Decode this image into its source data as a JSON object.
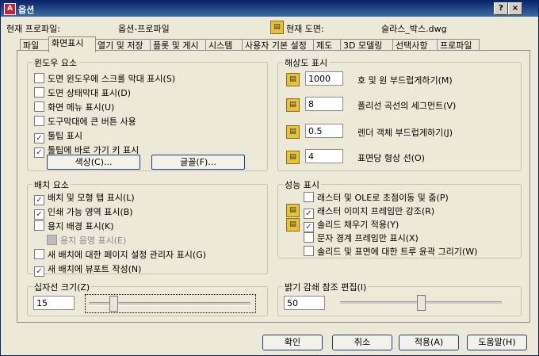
{
  "title_bar": {
    "title": "옵션",
    "help_button": "?",
    "close_button": "×"
  },
  "header": {
    "profile_label": "현재 프로파일:",
    "profile_value": "옵션-프로파일",
    "drawing_label": "현재 도면:",
    "drawing_value": "슬라스_박스.dwg"
  },
  "tabs": [
    {
      "label": "파일"
    },
    {
      "label": "화면표시",
      "active": true
    },
    {
      "label": "열기 및 저장"
    },
    {
      "label": "플롯 및 게시"
    },
    {
      "label": "시스템"
    },
    {
      "label": "사용자 기본 설정"
    },
    {
      "label": "제도"
    },
    {
      "label": "3D 모델링"
    },
    {
      "label": "선택사항"
    },
    {
      "label": "프로파일"
    }
  ],
  "window_elements": {
    "title": "윈도우 요소",
    "options": [
      {
        "label": "도면 윈도우에 스크롤 막대 표시(S)",
        "checked": false
      },
      {
        "label": "도면 상태막대 표시(D)",
        "checked": false
      },
      {
        "label": "화면 메뉴 표시(U)",
        "checked": false
      },
      {
        "label": "도구막대에 큰 버튼 사용",
        "checked": false
      },
      {
        "label": "툴팁 표시",
        "checked": true
      },
      {
        "label": "툴팁에 바로 가기 키 표시",
        "checked": true
      }
    ],
    "colors_button": "색상(C)...",
    "fonts_button": "글꼴(F)..."
  },
  "layout_elements": {
    "title": "배치 요소",
    "options": [
      {
        "label": "배치 및 모형 탭 표시(L)",
        "checked": true
      },
      {
        "label": "인쇄 가능 영역 표시(B)",
        "checked": true
      },
      {
        "label": "용지 배경 표시(K)",
        "checked": false
      },
      {
        "label": "용지 음영 표시(E)",
        "checked": false,
        "disabled": true
      },
      {
        "label": "새 배치에 대한 페이지 설정 관리자 표시(G)",
        "checked": false
      },
      {
        "label": "새 배치에 뷰포트 작성(N)",
        "checked": true
      }
    ]
  },
  "crosshair": {
    "title": "십자선 크기(Z)",
    "value": "15",
    "slider_percent": 15
  },
  "resolution": {
    "title": "해상도 표시",
    "items": [
      {
        "value": "1000",
        "label": "호 및 원 부드럽게하기(M)"
      },
      {
        "value": "8",
        "label": "폴리선 곡선의 세그먼트(V)"
      },
      {
        "value": "0.5",
        "label": "렌더 객체 부드럽게하기(J)"
      },
      {
        "value": "4",
        "label": "표면당 형상 선(O)"
      }
    ]
  },
  "performance": {
    "title": "성능 표시",
    "options": [
      {
        "label": "래스터 및 OLE로 초점이동 및 줌(P)",
        "checked": false
      },
      {
        "label": "래스터 이미지 프레임만 강조(R)",
        "checked": true
      },
      {
        "label": "솔리드 채우기 적용(Y)",
        "checked": true
      },
      {
        "label": "문자 경계 프레임만 표시(X)",
        "checked": false
      },
      {
        "label": "솔리드 및 표면에 대한 트루 윤곽 그리기(W)",
        "checked": false
      }
    ]
  },
  "fade": {
    "title": "밝기 감쇄 참조 편집(I)",
    "value": "50",
    "slider_percent": 50
  },
  "buttons": {
    "ok": "확인",
    "cancel": "취소",
    "apply": "적용(A)",
    "help": "도움말(H)"
  },
  "icons": {
    "drawing_icon": "dwg-saved-in-drawing-icon",
    "setting_icon": "dwg-saved-in-drawing-icon"
  }
}
